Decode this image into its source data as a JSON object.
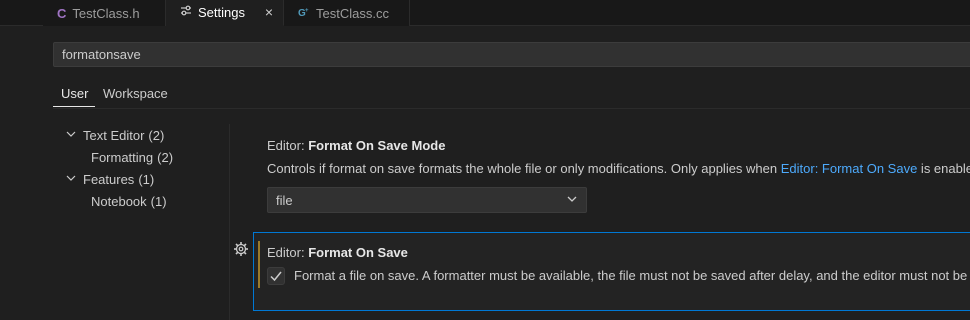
{
  "tabs": [
    {
      "icon": "C",
      "label": "TestClass.h"
    },
    {
      "icon": "⚙",
      "label": "Settings",
      "close": "×"
    },
    {
      "icon": "G",
      "label": "TestClass.cc"
    }
  ],
  "search": {
    "value": "formatonsave"
  },
  "scope_tabs": [
    {
      "label": "User"
    },
    {
      "label": "Workspace"
    }
  ],
  "toc": [
    {
      "label": "Text Editor",
      "count": "(2)"
    },
    {
      "label": "Formatting",
      "count": "(2)"
    },
    {
      "label": "Features",
      "count": "(1)"
    },
    {
      "label": "Notebook",
      "count": "(1)"
    }
  ],
  "settings": [
    {
      "category": "Editor: ",
      "name": "Format On Save Mode",
      "desc_before": "Controls if format on save formats the whole file or only modifications. Only applies when ",
      "desc_link": "Editor: Format On Save",
      "desc_after": " is enable",
      "value": "file"
    },
    {
      "category": "Editor: ",
      "name": "Format On Save",
      "desc": "Format a file on save. A formatter must be available, the file must not be saved after delay, and the editor must not be",
      "checked": true
    }
  ],
  "colors": {
    "accent": "#0078d4",
    "link": "#4daafc",
    "c_icon": "#a074c4",
    "cpp_icon": "#519aba"
  }
}
